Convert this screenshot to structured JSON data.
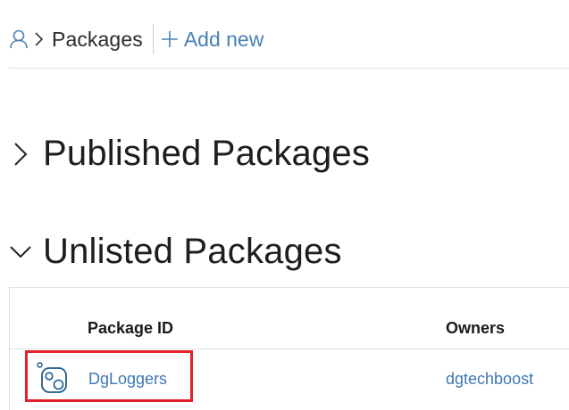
{
  "breadcrumb": {
    "user_icon": "user-icon",
    "separator_icon": "chevron-right-icon",
    "current": "Packages",
    "add_new_icon": "plus-icon",
    "add_new_label": "Add new"
  },
  "sections": {
    "published": {
      "title": "Published Packages",
      "expanded": false,
      "icon": "chevron-right-icon"
    },
    "unlisted": {
      "title": "Unlisted Packages",
      "expanded": true,
      "icon": "chevron-down-icon"
    }
  },
  "table": {
    "columns": [
      "Package ID",
      "Owners"
    ],
    "rows": [
      {
        "icon": "package-icon",
        "package_id": "DgLoggers",
        "owners": "dgtechboost"
      }
    ]
  },
  "colors": {
    "link": "#3d78b3",
    "highlight": "#e2232a",
    "divider": "#e1e1e1"
  }
}
